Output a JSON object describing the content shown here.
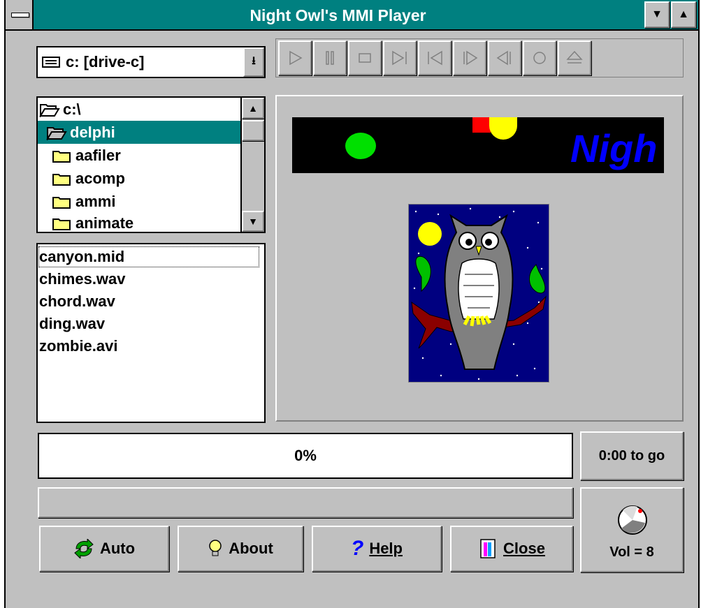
{
  "window": {
    "title": "Night Owl's MMI Player"
  },
  "drive": {
    "value": "c: [drive-c]"
  },
  "dirs": [
    {
      "label": "c:\\"
    },
    {
      "label": "delphi"
    },
    {
      "label": "aafiler"
    },
    {
      "label": "acomp"
    },
    {
      "label": "ammi"
    },
    {
      "label": "animate"
    }
  ],
  "files": [
    "canyon.mid",
    "chimes.wav",
    "chord.wav",
    "ding.wav",
    "zombie.avi"
  ],
  "banner": {
    "text": "Nigh"
  },
  "progress": {
    "label": "0%",
    "value": 0
  },
  "time_left": "0:00 to go",
  "status": "",
  "volume": {
    "label": "Vol = 8",
    "value": 8
  },
  "buttons": {
    "auto": "Auto",
    "about": "About",
    "help": "Help",
    "close": "Close"
  },
  "colors": {
    "title_bar": "#008080",
    "face": "#c0c0c0",
    "banner_text": "#0000ff"
  }
}
